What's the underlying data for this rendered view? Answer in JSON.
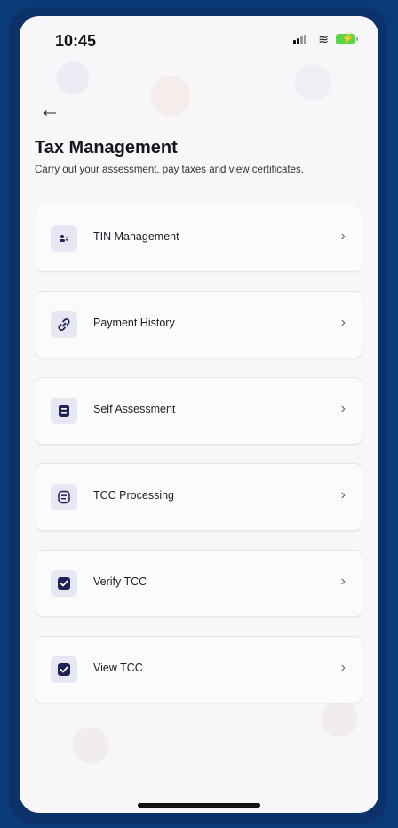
{
  "status": {
    "time": "10:45"
  },
  "header": {
    "title": "Tax Management",
    "subtitle": "Carry out your assessment, pay taxes and view certificates."
  },
  "menu": {
    "items": [
      {
        "label": "TIN Management",
        "icon": "id-card-icon"
      },
      {
        "label": "Payment History",
        "icon": "link-icon"
      },
      {
        "label": "Self Assessment",
        "icon": "document-icon"
      },
      {
        "label": "TCC Processing",
        "icon": "document-outline-icon"
      },
      {
        "label": "Verify TCC",
        "icon": "checkbox-icon"
      },
      {
        "label": "View TCC",
        "icon": "checkbox-icon"
      }
    ]
  },
  "colors": {
    "accent": "#1f2158",
    "icon_box": "#e7e7f3",
    "frame": "#0d326a"
  }
}
